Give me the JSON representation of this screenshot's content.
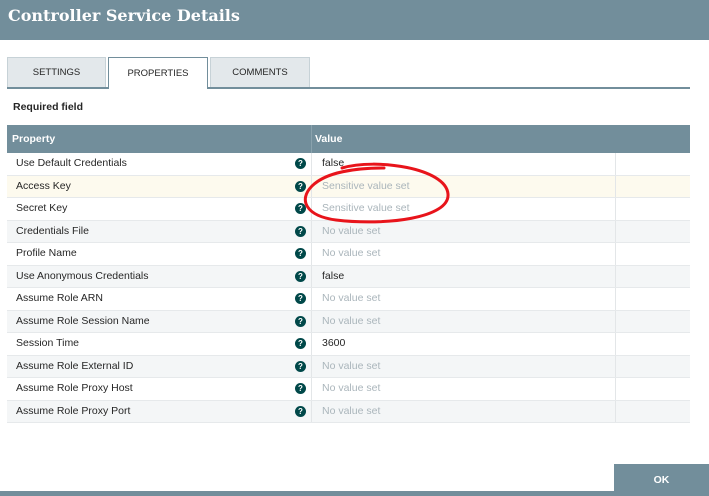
{
  "dialog": {
    "title": "Controller Service Details"
  },
  "tabs": [
    {
      "label": "SETTINGS",
      "active": false
    },
    {
      "label": "PROPERTIES",
      "active": true
    },
    {
      "label": "COMMENTS",
      "active": false
    }
  ],
  "required_label": "Required field",
  "table": {
    "columns": [
      "Property",
      "Value"
    ],
    "rows": [
      {
        "name": "Use Default Credentials",
        "value": "false",
        "value_state": "set"
      },
      {
        "name": "Access Key",
        "value": "Sensitive value set",
        "value_state": "sensitive"
      },
      {
        "name": "Secret Key",
        "value": "Sensitive value set",
        "value_state": "sensitive"
      },
      {
        "name": "Credentials File",
        "value": "No value set",
        "value_state": "empty"
      },
      {
        "name": "Profile Name",
        "value": "No value set",
        "value_state": "empty"
      },
      {
        "name": "Use Anonymous Credentials",
        "value": "false",
        "value_state": "set"
      },
      {
        "name": "Assume Role ARN",
        "value": "No value set",
        "value_state": "empty"
      },
      {
        "name": "Assume Role Session Name",
        "value": "No value set",
        "value_state": "empty"
      },
      {
        "name": "Session Time",
        "value": "3600",
        "value_state": "set"
      },
      {
        "name": "Assume Role External ID",
        "value": "No value set",
        "value_state": "empty"
      },
      {
        "name": "Assume Role Proxy Host",
        "value": "No value set",
        "value_state": "empty"
      },
      {
        "name": "Assume Role Proxy Port",
        "value": "No value set",
        "value_state": "empty"
      }
    ]
  },
  "help_icon": {
    "name": "help-circle-icon",
    "glyph": "?"
  },
  "annotation_color": "#e8141b",
  "footer": {
    "ok_label": "OK"
  }
}
